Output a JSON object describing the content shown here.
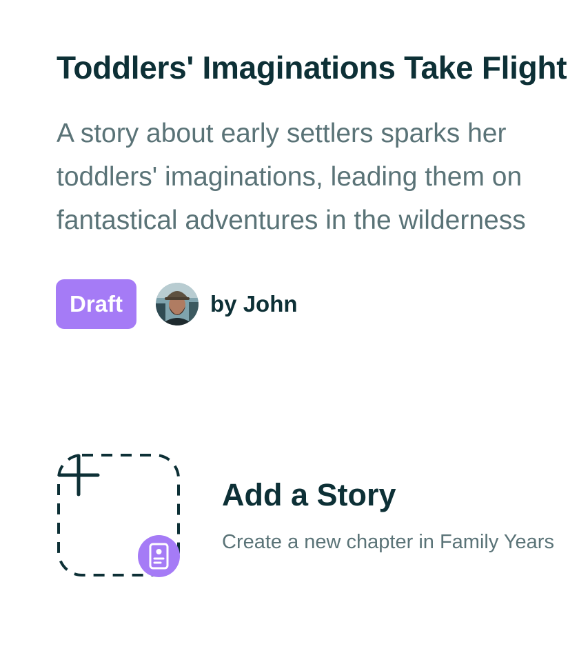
{
  "story": {
    "title": "Toddlers' Imaginations Take Flight",
    "description_lines": [
      "A story about early settlers sparks her",
      "toddlers' imaginations, leading them on",
      "fantastical adventures in the wilderness"
    ],
    "status": "Draft",
    "author": "by John",
    "avatar_icon": "user-photo-avatar"
  },
  "add_story": {
    "title": "Add a Story",
    "description": "Create a new chapter in Family Years",
    "plus_icon": "plus-icon",
    "badge_icon": "document-icon"
  },
  "colors": {
    "heading": "#0d3036",
    "body_text": "#5a7377",
    "accent": "#a57bf6",
    "background": "#ffffff"
  }
}
